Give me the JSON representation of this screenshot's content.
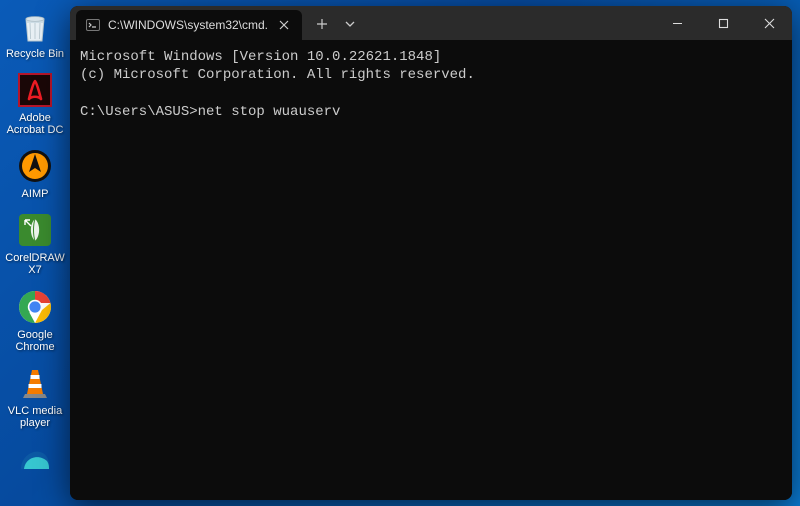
{
  "desktop": {
    "icons": [
      {
        "name": "recycle-bin",
        "label": "Recycle Bin"
      },
      {
        "name": "adobe-acrobat",
        "label": "Adobe Acrobat DC"
      },
      {
        "name": "aimp",
        "label": "AIMP"
      },
      {
        "name": "coreldraw",
        "label": "CorelDRAW X7"
      },
      {
        "name": "chrome",
        "label": "Google Chrome"
      },
      {
        "name": "vlc",
        "label": "VLC media player"
      },
      {
        "name": "edge",
        "label": ""
      }
    ]
  },
  "window": {
    "tab_title": "C:\\WINDOWS\\system32\\cmd."
  },
  "terminal": {
    "line1": "Microsoft Windows [Version 10.0.22621.1848]",
    "line2": "(c) Microsoft Corporation. All rights reserved.",
    "blank": "",
    "prompt": "C:\\Users\\ASUS>",
    "command": "net stop wuauserv"
  }
}
